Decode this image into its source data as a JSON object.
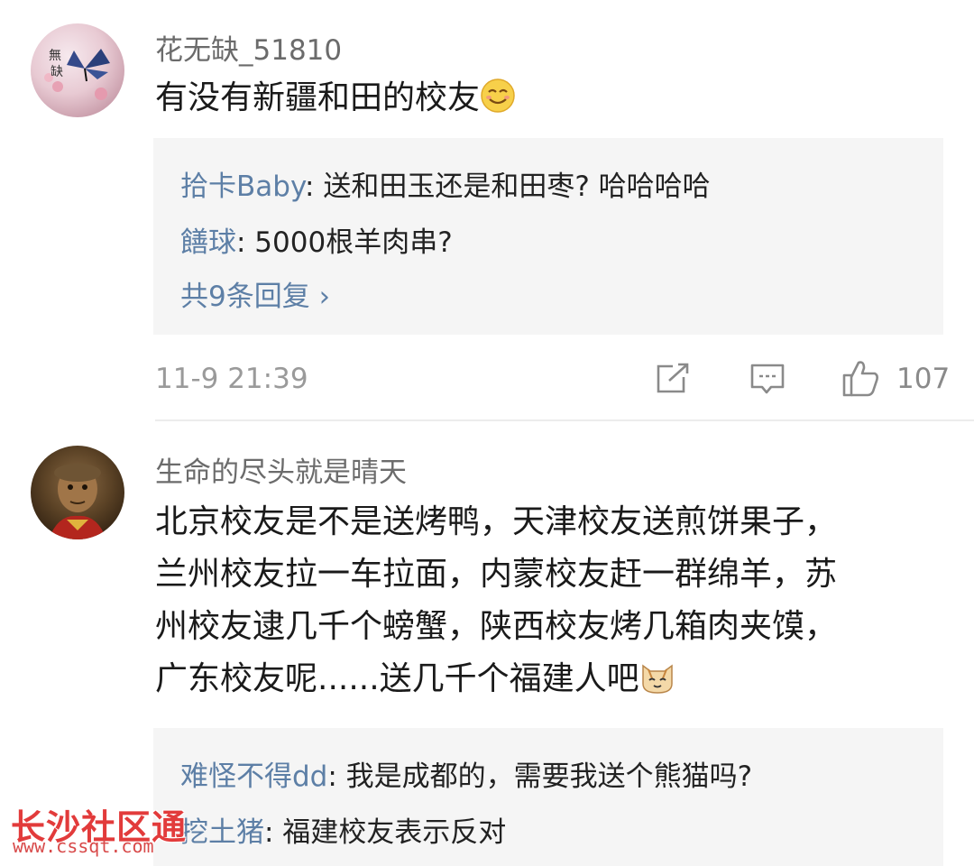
{
  "comments": [
    {
      "username": "花无缺_51810",
      "content": "有没有新疆和田的校友",
      "replies": [
        {
          "user": "拾卡Baby",
          "text": ": 送和田玉还是和田枣? 哈哈哈哈"
        },
        {
          "user": "饍球",
          "text": ": 5000根羊肉串?"
        }
      ],
      "more_replies": "共9条回复 ›",
      "timestamp": "11-9 21:39",
      "like_count": "107"
    },
    {
      "username": "生命的尽头就是晴天",
      "content_lines": [
        "北京校友是不是送烤鸭，天津校友送煎饼果子，",
        "兰州校友拉一车拉面，内蒙校友赶一群绵羊，苏",
        "州校友逮几千个螃蟹，陕西校友烤几箱肉夹馍，",
        "广东校友呢......送几千个福建人吧"
      ],
      "replies": [
        {
          "user": "难怪不得dd",
          "text": ": 我是成都的，需要我送个熊猫吗?"
        },
        {
          "user": "挖土猪",
          "text": ": 福建校友表示反对"
        }
      ]
    }
  ],
  "watermark": {
    "title": "长沙社区通",
    "url": "www.cssqt.com"
  },
  "icons": {
    "emoji_1": "smiling-face-icon",
    "emoji_2": "cat-face-icon",
    "share": "share-icon",
    "comment": "comment-icon",
    "like": "thumbs-up-icon"
  },
  "colors": {
    "link": "#5d7fa6",
    "reply_bg": "#f5f5f5",
    "watermark": "#e23b3b"
  }
}
